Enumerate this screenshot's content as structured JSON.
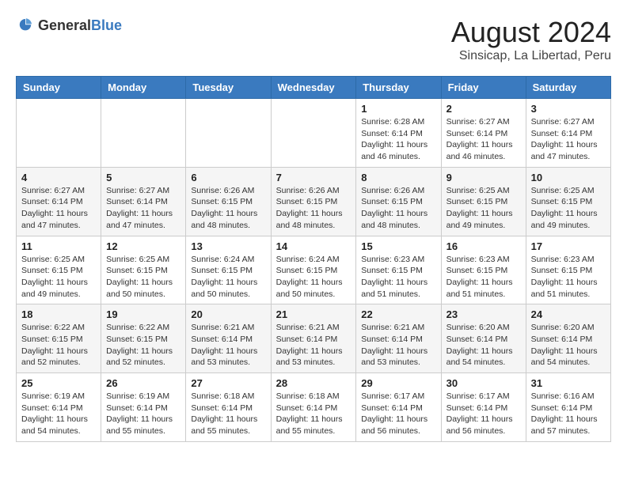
{
  "header": {
    "logo_general": "General",
    "logo_blue": "Blue",
    "month_year": "August 2024",
    "location": "Sinsicap, La Libertad, Peru"
  },
  "weekdays": [
    "Sunday",
    "Monday",
    "Tuesday",
    "Wednesday",
    "Thursday",
    "Friday",
    "Saturday"
  ],
  "weeks": [
    [
      {
        "day": "",
        "info": ""
      },
      {
        "day": "",
        "info": ""
      },
      {
        "day": "",
        "info": ""
      },
      {
        "day": "",
        "info": ""
      },
      {
        "day": "1",
        "info": "Sunrise: 6:28 AM\nSunset: 6:14 PM\nDaylight: 11 hours and 46 minutes."
      },
      {
        "day": "2",
        "info": "Sunrise: 6:27 AM\nSunset: 6:14 PM\nDaylight: 11 hours and 46 minutes."
      },
      {
        "day": "3",
        "info": "Sunrise: 6:27 AM\nSunset: 6:14 PM\nDaylight: 11 hours and 47 minutes."
      }
    ],
    [
      {
        "day": "4",
        "info": "Sunrise: 6:27 AM\nSunset: 6:14 PM\nDaylight: 11 hours and 47 minutes."
      },
      {
        "day": "5",
        "info": "Sunrise: 6:27 AM\nSunset: 6:14 PM\nDaylight: 11 hours and 47 minutes."
      },
      {
        "day": "6",
        "info": "Sunrise: 6:26 AM\nSunset: 6:15 PM\nDaylight: 11 hours and 48 minutes."
      },
      {
        "day": "7",
        "info": "Sunrise: 6:26 AM\nSunset: 6:15 PM\nDaylight: 11 hours and 48 minutes."
      },
      {
        "day": "8",
        "info": "Sunrise: 6:26 AM\nSunset: 6:15 PM\nDaylight: 11 hours and 48 minutes."
      },
      {
        "day": "9",
        "info": "Sunrise: 6:25 AM\nSunset: 6:15 PM\nDaylight: 11 hours and 49 minutes."
      },
      {
        "day": "10",
        "info": "Sunrise: 6:25 AM\nSunset: 6:15 PM\nDaylight: 11 hours and 49 minutes."
      }
    ],
    [
      {
        "day": "11",
        "info": "Sunrise: 6:25 AM\nSunset: 6:15 PM\nDaylight: 11 hours and 49 minutes."
      },
      {
        "day": "12",
        "info": "Sunrise: 6:25 AM\nSunset: 6:15 PM\nDaylight: 11 hours and 50 minutes."
      },
      {
        "day": "13",
        "info": "Sunrise: 6:24 AM\nSunset: 6:15 PM\nDaylight: 11 hours and 50 minutes."
      },
      {
        "day": "14",
        "info": "Sunrise: 6:24 AM\nSunset: 6:15 PM\nDaylight: 11 hours and 50 minutes."
      },
      {
        "day": "15",
        "info": "Sunrise: 6:23 AM\nSunset: 6:15 PM\nDaylight: 11 hours and 51 minutes."
      },
      {
        "day": "16",
        "info": "Sunrise: 6:23 AM\nSunset: 6:15 PM\nDaylight: 11 hours and 51 minutes."
      },
      {
        "day": "17",
        "info": "Sunrise: 6:23 AM\nSunset: 6:15 PM\nDaylight: 11 hours and 51 minutes."
      }
    ],
    [
      {
        "day": "18",
        "info": "Sunrise: 6:22 AM\nSunset: 6:15 PM\nDaylight: 11 hours and 52 minutes."
      },
      {
        "day": "19",
        "info": "Sunrise: 6:22 AM\nSunset: 6:15 PM\nDaylight: 11 hours and 52 minutes."
      },
      {
        "day": "20",
        "info": "Sunrise: 6:21 AM\nSunset: 6:14 PM\nDaylight: 11 hours and 53 minutes."
      },
      {
        "day": "21",
        "info": "Sunrise: 6:21 AM\nSunset: 6:14 PM\nDaylight: 11 hours and 53 minutes."
      },
      {
        "day": "22",
        "info": "Sunrise: 6:21 AM\nSunset: 6:14 PM\nDaylight: 11 hours and 53 minutes."
      },
      {
        "day": "23",
        "info": "Sunrise: 6:20 AM\nSunset: 6:14 PM\nDaylight: 11 hours and 54 minutes."
      },
      {
        "day": "24",
        "info": "Sunrise: 6:20 AM\nSunset: 6:14 PM\nDaylight: 11 hours and 54 minutes."
      }
    ],
    [
      {
        "day": "25",
        "info": "Sunrise: 6:19 AM\nSunset: 6:14 PM\nDaylight: 11 hours and 54 minutes."
      },
      {
        "day": "26",
        "info": "Sunrise: 6:19 AM\nSunset: 6:14 PM\nDaylight: 11 hours and 55 minutes."
      },
      {
        "day": "27",
        "info": "Sunrise: 6:18 AM\nSunset: 6:14 PM\nDaylight: 11 hours and 55 minutes."
      },
      {
        "day": "28",
        "info": "Sunrise: 6:18 AM\nSunset: 6:14 PM\nDaylight: 11 hours and 55 minutes."
      },
      {
        "day": "29",
        "info": "Sunrise: 6:17 AM\nSunset: 6:14 PM\nDaylight: 11 hours and 56 minutes."
      },
      {
        "day": "30",
        "info": "Sunrise: 6:17 AM\nSunset: 6:14 PM\nDaylight: 11 hours and 56 minutes."
      },
      {
        "day": "31",
        "info": "Sunrise: 6:16 AM\nSunset: 6:14 PM\nDaylight: 11 hours and 57 minutes."
      }
    ]
  ]
}
